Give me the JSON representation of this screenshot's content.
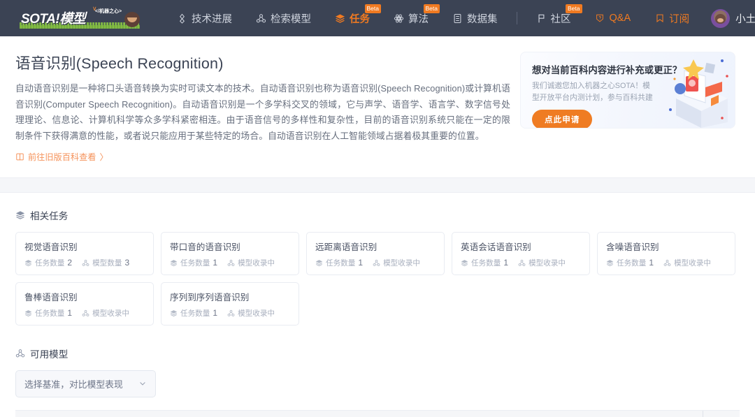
{
  "header": {
    "logo": {
      "text": "SOTA!模型",
      "sub": "</机器之心>",
      "caret": "∨"
    },
    "nav": [
      {
        "label": "技术进展",
        "icon": "compass-icon",
        "state": "default",
        "beta": ""
      },
      {
        "label": "检索模型",
        "icon": "share-nodes-icon",
        "state": "default",
        "beta": ""
      },
      {
        "label": "任务",
        "icon": "layers-icon",
        "state": "active",
        "beta": "Beta"
      },
      {
        "label": "算法",
        "icon": "atom-icon",
        "state": "default",
        "beta": "Beta"
      },
      {
        "label": "数据集",
        "icon": "database-icon",
        "state": "default",
        "beta": ""
      },
      {
        "label": "社区",
        "icon": "flag-icon",
        "state": "default",
        "beta": "Beta"
      },
      {
        "label": "Q&A",
        "icon": "question-shield-icon",
        "state": "orange",
        "beta": ""
      },
      {
        "label": "订阅",
        "icon": "bookmark-icon",
        "state": "orange",
        "beta": ""
      }
    ],
    "user": {
      "name": "小土同学",
      "avatar": "user-avatar"
    },
    "colors": {
      "bar": "#3b4354",
      "accent": "#f07a21",
      "nav_text": "#cfd4de"
    }
  },
  "hero": {
    "title": "语音识别(Speech Recognition)",
    "description": "自动语音识别是一种将口头语音转换为实时可读文本的技术。自动语音识别也称为语音识别(Speech Recognition)或计算机语音识别(Computer Speech Recognition)。自动语音识别是一个多学科交叉的领域，它与声学、语音学、语言学、数字信号处理理论、信息论、计算机科学等众多学科紧密相连。由于语音信号的多样性和复杂性，目前的语音识别系统只能在一定的限制条件下获得满意的性能，或者说只能应用于某些特定的场合。自动语音识别在人工智能领域占据着极其重要的位置。",
    "old_wiki_link": "前往旧版百科查看",
    "old_wiki_chevron": "〉"
  },
  "promo": {
    "title": "想对当前百科内容进行补充或更正？",
    "subtitle": "我们诚邀您加入机器之心SOTA！模型开放平台内测计划，参与百科共建",
    "button": "点此申请",
    "button_color": "#ef7c23"
  },
  "related_tasks": {
    "section_title": "相关任务",
    "section_icon": "layers-icon",
    "task_count_label": "任务数量",
    "model_count_label": "模型数量",
    "model_pending_label": "模型收录中",
    "cards": [
      {
        "name": "视觉语音识别",
        "task_count": "2",
        "model_count": "3",
        "model_pending": false
      },
      {
        "name": "带口音的语音识别",
        "task_count": "1",
        "model_count": "",
        "model_pending": true
      },
      {
        "name": "远距离语音识别",
        "task_count": "1",
        "model_count": "",
        "model_pending": true
      },
      {
        "name": "英语会话语音识别",
        "task_count": "1",
        "model_count": "",
        "model_pending": true
      },
      {
        "name": "含噪语音识别",
        "task_count": "1",
        "model_count": "",
        "model_pending": true
      },
      {
        "name": "鲁棒语音识别",
        "task_count": "1",
        "model_count": "",
        "model_pending": true
      },
      {
        "name": "序列到序列语音识别",
        "task_count": "1",
        "model_count": "",
        "model_pending": true
      }
    ]
  },
  "available_models": {
    "section_title": "可用模型",
    "section_icon": "share-nodes-icon",
    "select_label": "选择基准，对比模型表现",
    "select_chevron": "chevron-down-icon"
  }
}
